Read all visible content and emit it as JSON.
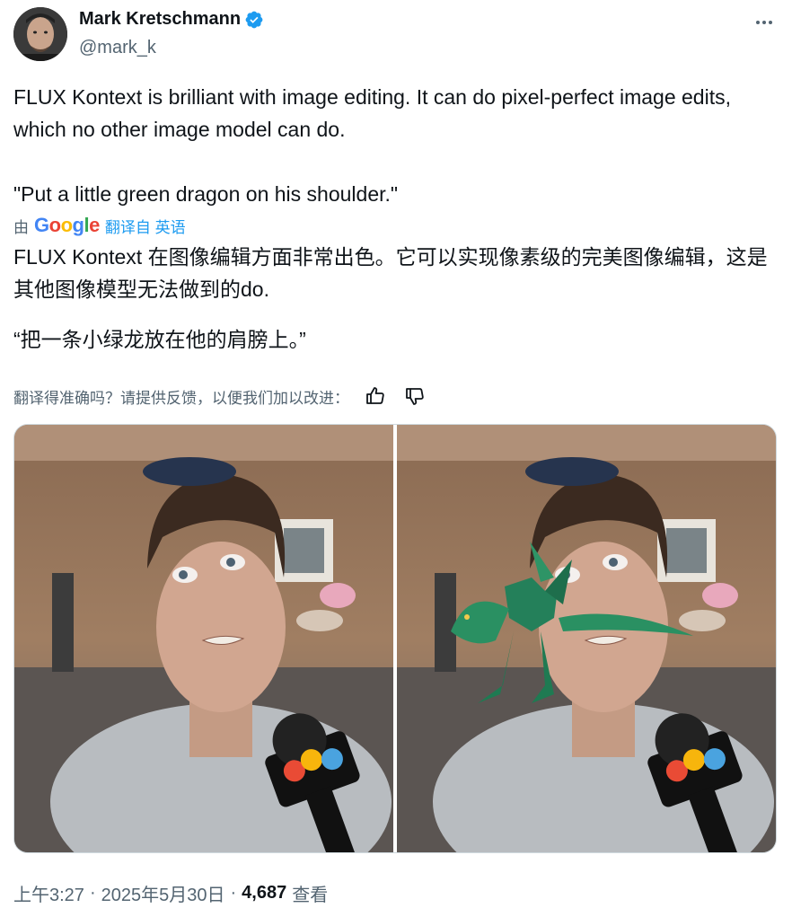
{
  "author": {
    "name": "Mark Kretschmann",
    "handle": "@mark_k",
    "verified_color": "#1d9bf0"
  },
  "tweet": {
    "text_en": "FLUX Kontext is brilliant with image editing. It can do pixel-perfect image edits, which no other image model can do.",
    "quote_en": "\"Put a little green dragon on his shoulder.\"",
    "translate_prefix": "由",
    "google_logo": [
      "G",
      "o",
      "o",
      "g",
      "l",
      "e"
    ],
    "translate_link": "翻译自 英语",
    "text_zh": "FLUX Kontext 在图像编辑方面非常出色。它可以实现像素级的完美图像编辑，这是其他图像模型无法做到的do.",
    "quote_zh": "“把一条小绿龙放在他的肩膀上。”",
    "feedback_prompt": "翻译得准确吗？请提供反馈，以便我们加以改进："
  },
  "icons": {
    "more": "more-horizontal-icon",
    "thumbs_up": "thumbs-up-icon",
    "thumbs_down": "thumbs-down-icon",
    "verified": "verified-badge-icon"
  },
  "media": {
    "count": 2
  },
  "meta": {
    "time": "上午3:27",
    "separator": "·",
    "date": "2025年5月30日",
    "views_count": "4,687",
    "views_label": "查看"
  }
}
